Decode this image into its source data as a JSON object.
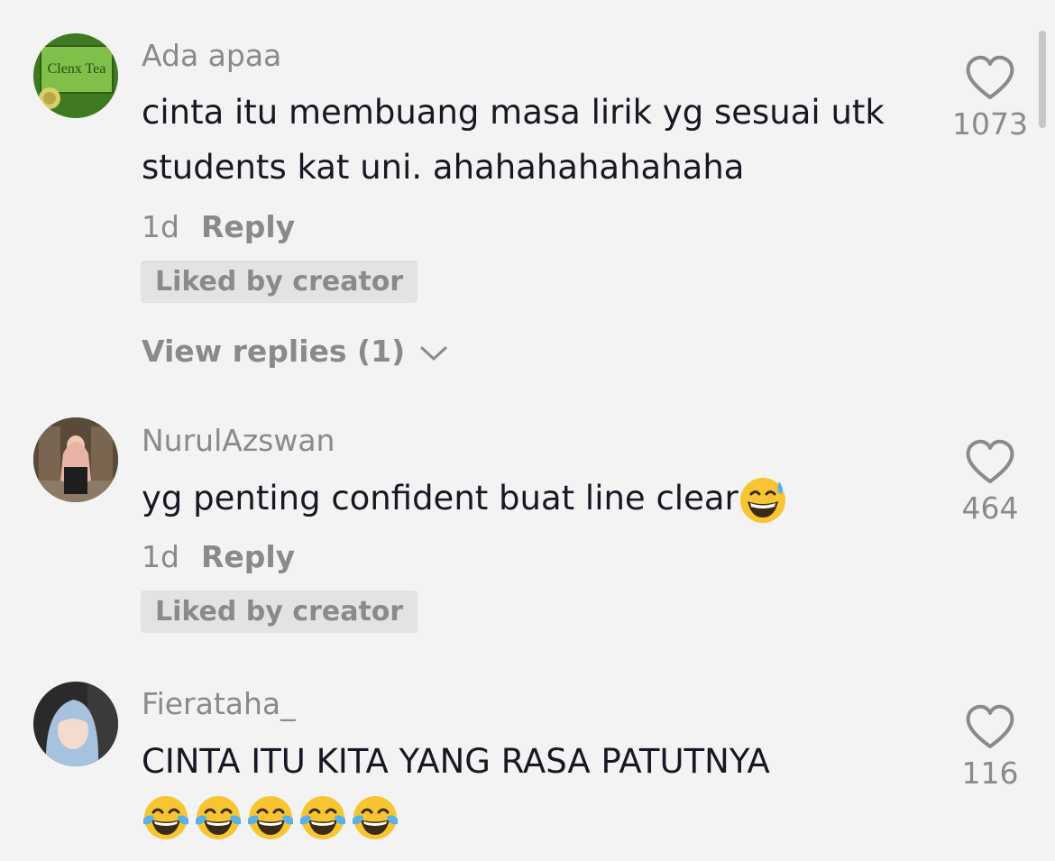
{
  "comments": [
    {
      "username": "Ada apaa",
      "text": "cinta itu membuang masa lirik yg sesuai utk students kat uni. ahahahahahahaha",
      "time": "1d",
      "reply_label": "Reply",
      "badge": "Liked by creator",
      "view_replies": "View replies (1)",
      "likes": "1073",
      "avatar_text": "Clenx Tea"
    },
    {
      "username": "NurulAzswan",
      "text": "yg penting confident buat line clear",
      "time": "1d",
      "reply_label": "Reply",
      "badge": "Liked by creator",
      "likes": "464"
    },
    {
      "username": "Fierataha_",
      "text": "CINTA ITU KITA YANG RASA PATUTNYA",
      "likes": "116"
    }
  ],
  "icons": {
    "like": "heart-outline-icon",
    "expand": "chevron-down-icon",
    "emoji_sweat": "grinning-face-with-sweat-emoji",
    "emoji_laugh": "face-with-tears-of-joy-emoji"
  },
  "colors": {
    "background": "#f3f3f3",
    "text": "#161823",
    "muted": "#8a8a8a",
    "badge_bg": "#e3e3e3"
  }
}
